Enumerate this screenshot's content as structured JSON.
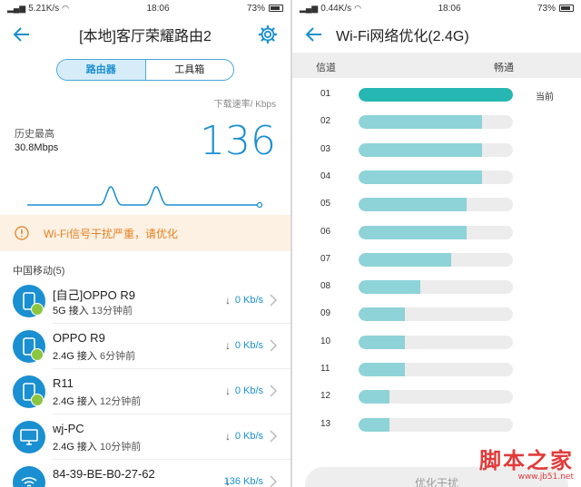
{
  "left": {
    "status": {
      "speed": "5.21K/s",
      "time": "18:06",
      "battery": "73%"
    },
    "title": "[本地]客厅荣耀路由2",
    "tabs": [
      {
        "label": "路由器"
      },
      {
        "label": "工具箱"
      }
    ],
    "speed_caption": "下载速率/ Kbps",
    "history_label": "历史最高",
    "history_value": "30.8Mbps",
    "current_speed": "136",
    "warning": "Wi-Fi信号干扰严重，请优化",
    "section": "中国移动(5)",
    "devices": [
      {
        "name": "[自己]OPPO R9",
        "band": "5G 接入",
        "time": "13分钟前",
        "rate": "0 Kb/s",
        "icon": "phone-icon"
      },
      {
        "name": "OPPO R9",
        "band": "2.4G 接入",
        "time": "6分钟前",
        "rate": "0 Kb/s",
        "icon": "phone-icon"
      },
      {
        "name": "R11",
        "band": "2.4G 接入",
        "time": "12分钟前",
        "rate": "0 Kb/s",
        "icon": "phone-icon"
      },
      {
        "name": "wj-PC",
        "band": "2.4G 接入",
        "time": "10分钟前",
        "rate": "0 Kb/s",
        "icon": "monitor-icon"
      },
      {
        "name": "84-39-BE-B0-27-62",
        "band": "",
        "time": "",
        "rate": "136 Kb/s",
        "icon": "wifi-icon"
      }
    ],
    "accent": "#1a8fd1",
    "warning_color": "#e6801f"
  },
  "right": {
    "status": {
      "speed": "0.44K/s",
      "time": "18:06",
      "battery": "73%"
    },
    "title": "Wi-Fi网络优化(2.4G)",
    "header_channel": "信道",
    "header_smooth": "畅通",
    "current_label": "当前",
    "channels": [
      {
        "ch": "01",
        "smoothness": 1.0,
        "current": true
      },
      {
        "ch": "02",
        "smoothness": 0.8
      },
      {
        "ch": "03",
        "smoothness": 0.8
      },
      {
        "ch": "04",
        "smoothness": 0.8
      },
      {
        "ch": "05",
        "smoothness": 0.7
      },
      {
        "ch": "06",
        "smoothness": 0.7
      },
      {
        "ch": "07",
        "smoothness": 0.6
      },
      {
        "ch": "08",
        "smoothness": 0.4
      },
      {
        "ch": "09",
        "smoothness": 0.3
      },
      {
        "ch": "10",
        "smoothness": 0.3
      },
      {
        "ch": "11",
        "smoothness": 0.3
      },
      {
        "ch": "12",
        "smoothness": 0.2
      },
      {
        "ch": "13",
        "smoothness": 0.2
      }
    ],
    "optimize_button": "优化干扰",
    "bar_color": "#8dd3d8",
    "current_bar_color": "#27b7b3"
  },
  "watermark": {
    "brand": "脚本之家",
    "url": "www.jb51.net"
  }
}
